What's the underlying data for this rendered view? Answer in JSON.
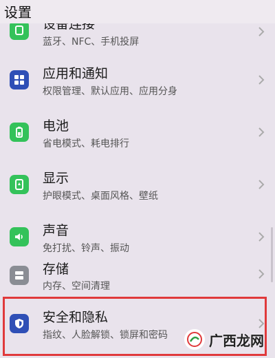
{
  "header": {
    "title": "设置"
  },
  "items": [
    {
      "title": "设备连接",
      "subtitle": "蓝牙、NFC、手机投屏",
      "icon": "device-connection-icon"
    },
    {
      "title": "应用和通知",
      "subtitle": "权限管理、默认应用、应用分身",
      "icon": "apps-grid-icon"
    },
    {
      "title": "电池",
      "subtitle": "省电模式、耗电排行",
      "icon": "battery-icon"
    },
    {
      "title": "显示",
      "subtitle": "护眼模式、桌面风格、壁纸",
      "icon": "display-icon"
    },
    {
      "title": "声音",
      "subtitle": "免打扰、铃声、振动",
      "icon": "sound-icon"
    },
    {
      "title": "存储",
      "subtitle": "内存、空间清理",
      "icon": "storage-icon"
    },
    {
      "title": "安全和隐私",
      "subtitle": "指纹、人脸解锁、锁屏和密码",
      "icon": "shield-icon"
    }
  ],
  "watermark": {
    "text": "广西龙网"
  },
  "colors": {
    "green": "#34c25a",
    "blue": "#2f4fb6",
    "gray": "#8a8d94",
    "highlight": "#e0393b"
  }
}
